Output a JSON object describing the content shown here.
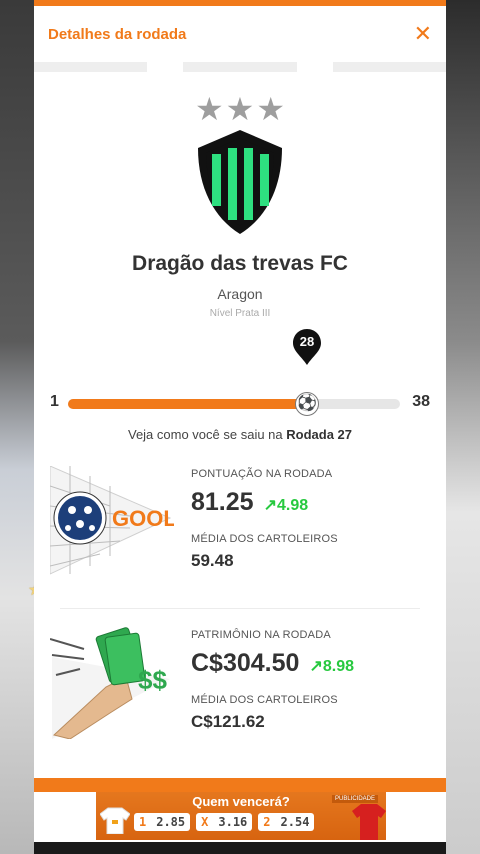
{
  "header": {
    "title": "Detalhes da rodada",
    "close_label": "✕"
  },
  "team": {
    "stars": "★★★",
    "name": "Dragão das trevas FC",
    "owner": "Aragon",
    "level": "Nível Prata III"
  },
  "progress": {
    "min": "1",
    "max": "38",
    "current": "28",
    "fraction": 0.72
  },
  "round_note": {
    "prefix": "Veja como você se saiu na",
    "round": "Rodada 27"
  },
  "score": {
    "icon_text": "GOOL",
    "label": "PONTUAÇÃO NA RODADA",
    "value": "81.25",
    "delta": "4.98",
    "avg_label": "MÉDIA DOS CARTOLEIROS",
    "avg_value": "59.48"
  },
  "patrimony": {
    "icon_text": "$$",
    "label": "PATRIMÔNIO NA RODADA",
    "value": "C$304.50",
    "delta": "8.98",
    "avg_label": "MÉDIA DOS CARTOLEIROS",
    "avg_value": "C$121.62"
  },
  "ad": {
    "title": "Quem vencerá?",
    "tag": "PUBLICIDADE",
    "odds": [
      {
        "key": "1",
        "value": "2.85"
      },
      {
        "key": "X",
        "value": "3.16"
      },
      {
        "key": "2",
        "value": "2.54"
      }
    ]
  },
  "colors": {
    "accent": "#f17a1a",
    "positive": "#27c93f",
    "crest_green": "#2ee080"
  },
  "icons": [
    "close-icon",
    "star-icon",
    "shield-icon",
    "map-pin-icon",
    "soccer-ball-icon",
    "arrow-up-icon",
    "money-hand-icon",
    "soccer-net-icon"
  ]
}
